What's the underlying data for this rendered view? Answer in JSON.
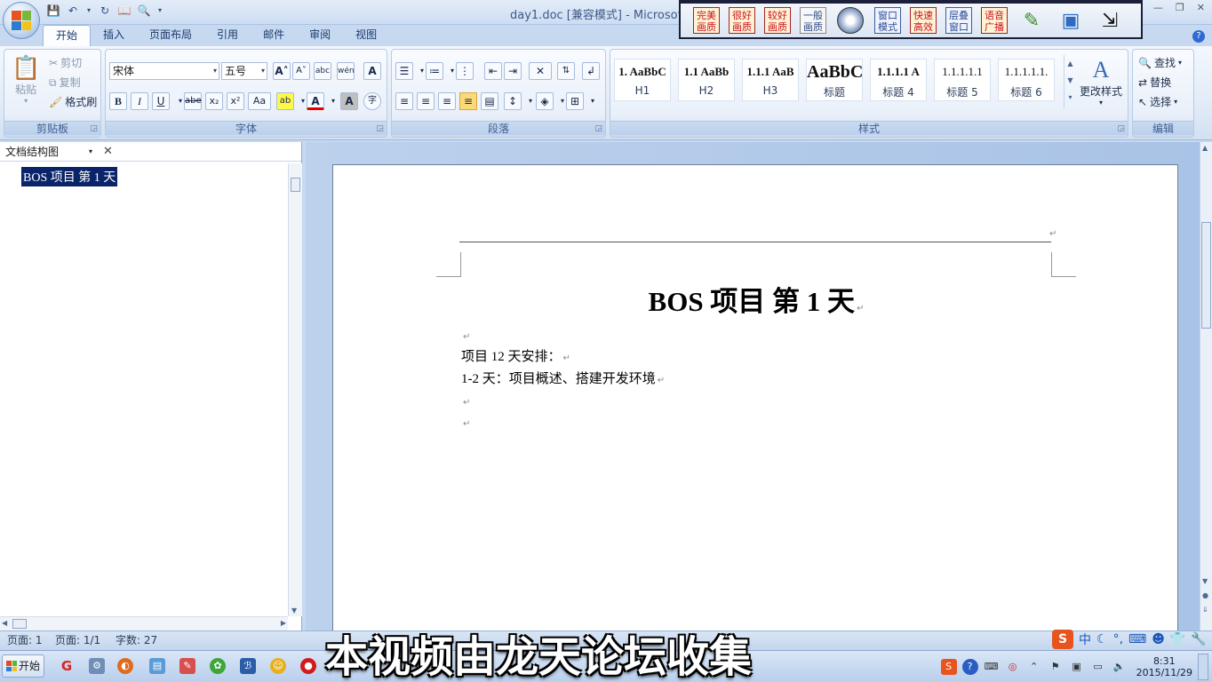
{
  "window": {
    "title": "day1.doc [兼容模式] - Microsoft W",
    "minimize": "—",
    "restore": "❐",
    "close": "✕"
  },
  "quick_access": {
    "save_icon": "save-icon",
    "undo_icon": "undo-icon",
    "redo_icon": "redo-icon"
  },
  "recorder": {
    "buttons": [
      {
        "top": "完美",
        "bottom": "画质"
      },
      {
        "top": "很好",
        "bottom": "画质"
      },
      {
        "top": "较好",
        "bottom": "画质"
      },
      {
        "top": "一般",
        "bottom": "画质"
      },
      {
        "top": "窗口",
        "bottom": "模式"
      },
      {
        "top": "快速",
        "bottom": "高效"
      },
      {
        "top": "层叠",
        "bottom": "窗口"
      },
      {
        "top": "语音",
        "bottom": "广播"
      }
    ]
  },
  "tabs": [
    "开始",
    "插入",
    "页面布局",
    "引用",
    "邮件",
    "审阅",
    "视图"
  ],
  "ribbon": {
    "clipboard": {
      "label": "剪贴板",
      "paste": "粘贴",
      "cut": "剪切",
      "copy": "复制",
      "format_painter": "格式刷"
    },
    "font": {
      "label": "字体",
      "font_name": "宋体",
      "font_size": "五号",
      "grow": "A˄",
      "shrink": "A˅",
      "clear": "abc",
      "phonetic": "wén",
      "border_char": "A",
      "bold": "B",
      "italic": "I",
      "underline": "U",
      "strike": "abe",
      "subscript": "x₂",
      "superscript": "x²",
      "case": "Aa",
      "highlight": "ab",
      "color": "A",
      "shading": "A",
      "enclose": "字"
    },
    "paragraph": {
      "label": "段落"
    },
    "styles": {
      "label": "样式",
      "change_styles": "更改样式",
      "cards": [
        {
          "preview": "1.  AaBbC",
          "name": "H1"
        },
        {
          "preview": "1.1  AaBb",
          "name": "H2"
        },
        {
          "preview": "1.1.1  AaB",
          "name": "H3"
        },
        {
          "preview": "AaBbC",
          "name": "标题"
        },
        {
          "preview": "1.1.1.1  A",
          "name": "标题 4"
        },
        {
          "preview": "1.1.1.1.1",
          "name": "标题 5"
        },
        {
          "preview": "1.1.1.1.1.",
          "name": "标题 6"
        }
      ]
    },
    "editing": {
      "label": "编辑",
      "find": "查找",
      "replace": "替换",
      "select": "选择"
    }
  },
  "navpane": {
    "title": "文档结构图",
    "item": "BOS 项目  第 1 天"
  },
  "document": {
    "title": "BOS 项目   第 1 天",
    "paragraphs": [
      "",
      "项目 12 天安排：",
      "1-2 天：项目概述、搭建开发环境",
      "",
      ""
    ]
  },
  "status": {
    "page": "页面: 1",
    "pages": "页面: 1/1",
    "words": "字数: 27"
  },
  "ime": {
    "logo": "S",
    "mode": "中"
  },
  "taskbar": {
    "start": "开始",
    "time": "8:31",
    "date": "2015/11/29"
  },
  "caption": "本视频由龙天论坛收集",
  "colors": {
    "accent": "#2b579a",
    "nav_highlight": "#0a246a"
  }
}
